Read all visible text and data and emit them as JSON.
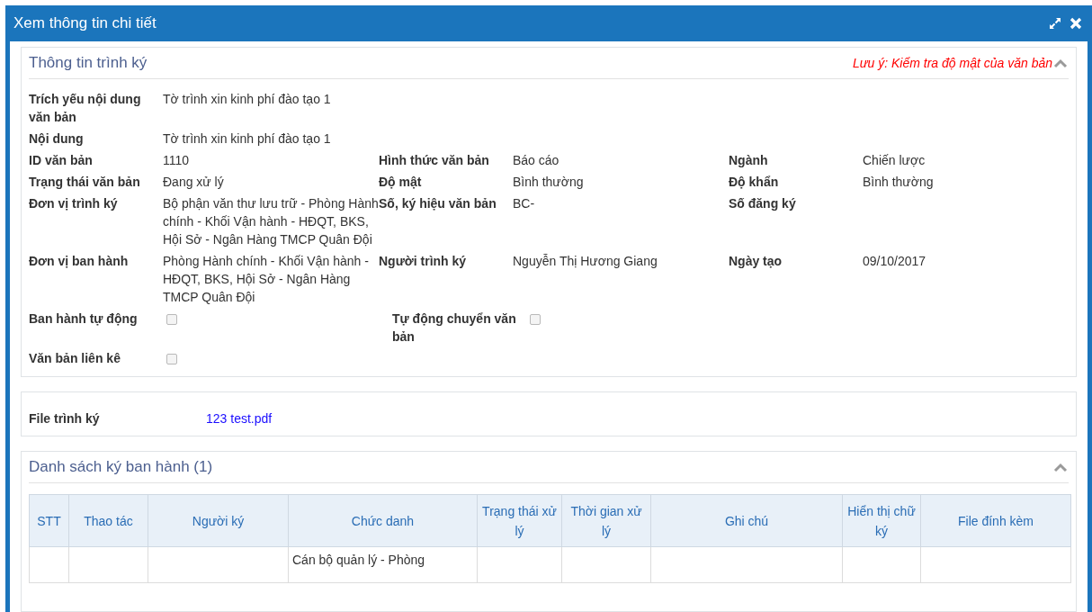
{
  "window": {
    "title": "Xem thông tin chi tiết"
  },
  "info_panel": {
    "title": "Thông tin trình ký",
    "note": "Lưu ý: Kiểm tra độ mật của văn bản",
    "expanded": true,
    "rows": [
      [
        {
          "kind": "text",
          "label": "Trích yếu nội dung văn bản",
          "value": "Tờ trình xin kinh phí đào tạo 1"
        }
      ],
      [
        {
          "kind": "text",
          "label": "Nội dung",
          "value": "Tờ trình xin kinh phí đào tạo 1"
        }
      ],
      [
        {
          "kind": "text",
          "label": "ID văn bản",
          "value": "1110"
        },
        {
          "kind": "text",
          "label": "Hình thức văn bản",
          "value": "Báo cáo"
        },
        {
          "kind": "text",
          "label": "Ngành",
          "value": "Chiến lược"
        }
      ],
      [
        {
          "kind": "text",
          "label": "Trạng thái văn bản",
          "value": "Đang xử lý"
        },
        {
          "kind": "text",
          "label": "Độ mật",
          "value": "Bình thường"
        },
        {
          "kind": "text",
          "label": "Độ khẩn",
          "value": "Bình thường"
        }
      ],
      [
        {
          "kind": "text",
          "label": "Đơn vị trình ký",
          "value": "Bộ phận văn thư lưu trữ - Phòng Hành chính - Khối Vận hành - HĐQT, BKS, Hội Sở - Ngân Hàng TMCP Quân Đội"
        },
        {
          "kind": "text",
          "label": "Số, ký hiệu văn bản",
          "value": "BC-"
        },
        {
          "kind": "text",
          "label": "Số đăng ký"
        }
      ],
      [
        {
          "kind": "text",
          "label": "Đơn vị ban hành",
          "value": "Phòng Hành chính - Khối Vận hành - HĐQT, BKS, Hội Sở - Ngân Hàng TMCP Quân Đội"
        },
        {
          "kind": "text",
          "label": "Người trình ký",
          "value": "Nguyễn Thị Hương Giang"
        },
        {
          "kind": "text",
          "label": "Ngày tạo",
          "value": "09/10/2017"
        }
      ],
      [
        {
          "kind": "checkbox",
          "label": "Ban hành tự động",
          "checked": false
        },
        {
          "kind": "checkbox",
          "label": "Tự động chuyển văn bản",
          "checked": false
        }
      ],
      [
        {
          "kind": "checkbox",
          "label": "Văn bản liên kê",
          "checked": false
        }
      ]
    ]
  },
  "file_panel": {
    "label": "File trình ký",
    "link": "123 test.pdf"
  },
  "sign_panel": {
    "title": "Danh sách ký ban hành (1)",
    "expanded": true,
    "table": {
      "columns": [
        "STT",
        "Thao tác",
        "Người ký",
        "Chức danh",
        "Trạng thái xử lý",
        "Thời gian xử lý",
        "Ghi chú",
        "Hiển thị chữ ký",
        "File đính kèm"
      ],
      "rows": [
        {
          "column_4": "Cán bộ quản lý - Phòng"
        }
      ]
    }
  }
}
